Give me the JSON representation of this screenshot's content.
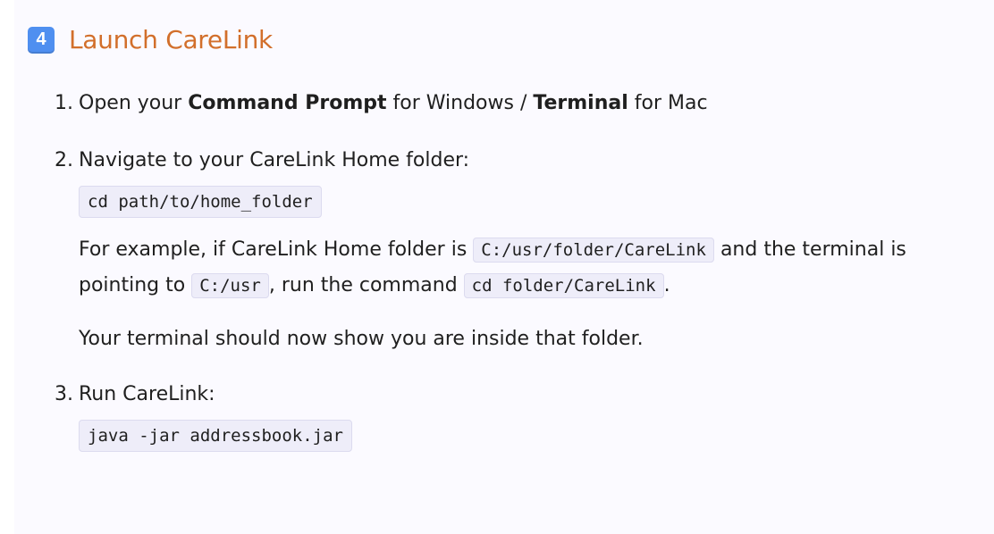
{
  "heading": {
    "badge": "4",
    "title": "Launch CareLink",
    "badge_color": "#4f8ff0",
    "title_color": "#d26f2b"
  },
  "steps": [
    {
      "number": "1.",
      "text_1": "Open your ",
      "bold_1": "Command Prompt",
      "text_2": " for Windows / ",
      "bold_2": "Terminal",
      "text_3": " for Mac"
    },
    {
      "number": "2.",
      "text": "Navigate to your CareLink Home folder:",
      "code": "cd path/to/home_folder",
      "example": {
        "part_1": "For example, if CareLink Home folder is ",
        "code_1": "C:/usr/folder/CareLink",
        "part_2": " and the terminal is pointing to ",
        "code_2": "C:/usr",
        "part_3": ", run the command ",
        "code_3": "cd folder/CareLink",
        "part_4": "."
      },
      "note": "Your terminal should now show you are inside that folder."
    },
    {
      "number": "3.",
      "text": "Run CareLink:",
      "code": "java -jar addressbook.jar"
    }
  ]
}
